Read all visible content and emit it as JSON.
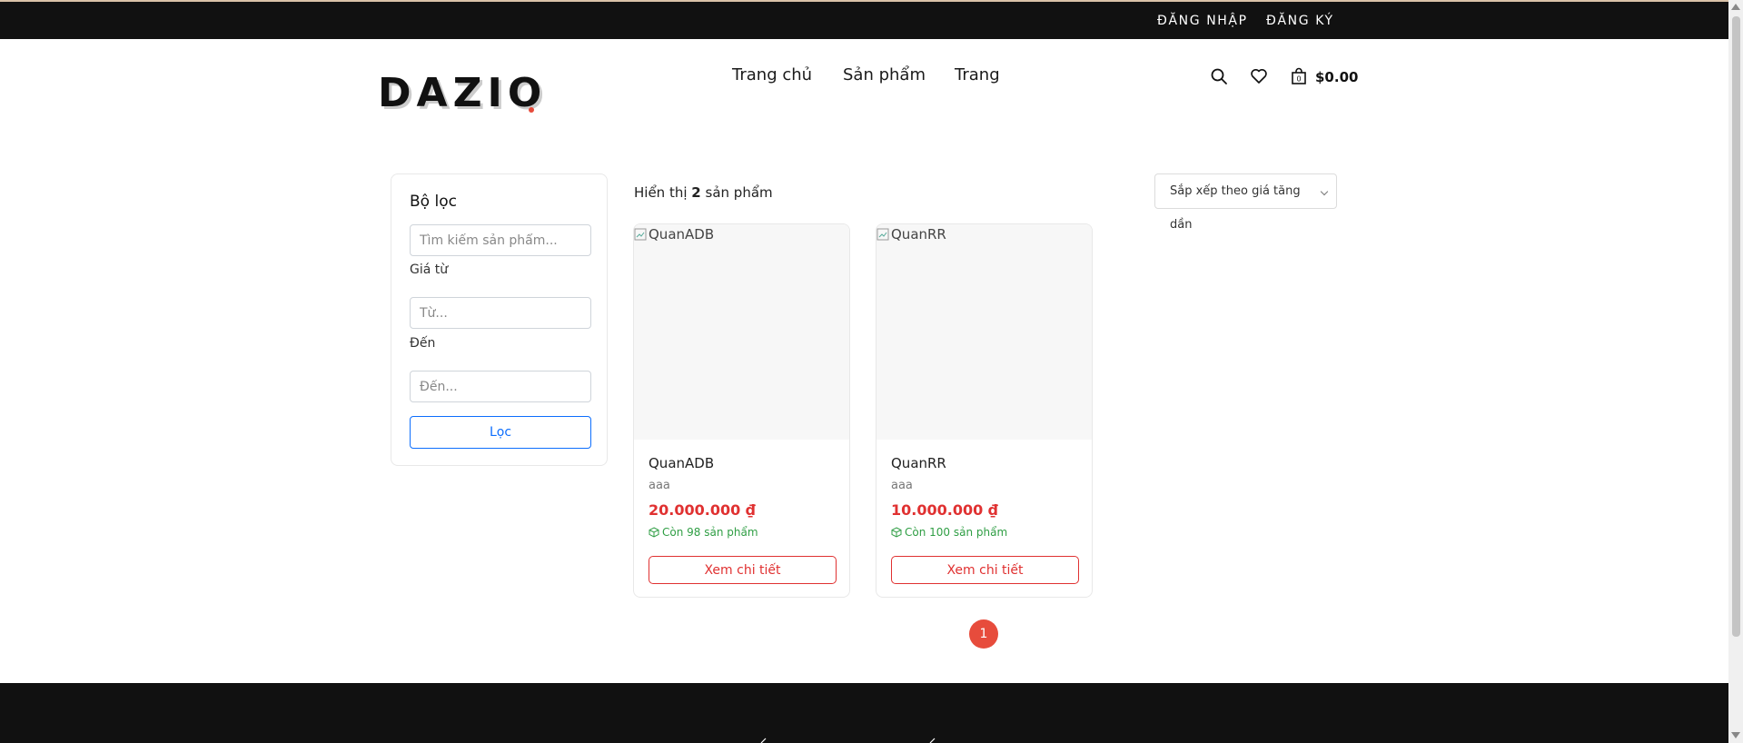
{
  "topbar": {
    "login_label": "ĐĂNG NHẬP",
    "register_label": "ĐĂNG KÝ"
  },
  "header": {
    "logo_text": "DAZIO",
    "nav": [
      {
        "label": "Trang chủ"
      },
      {
        "label": "Sản phẩm"
      },
      {
        "label": "Trang"
      }
    ],
    "cart_total": "$0.00",
    "icons": [
      "search-icon",
      "heart-icon",
      "cart-icon"
    ]
  },
  "filter": {
    "title": "Bộ lọc",
    "search_placeholder": "Tìm kiếm sản phẩm...",
    "price_from_label": "Giá từ",
    "price_from_placeholder": "Từ...",
    "price_to_label": "Đến",
    "price_to_placeholder": "Đến...",
    "submit_label": "Lọc"
  },
  "results": {
    "prefix": "Hiển thị",
    "count": "2",
    "suffix": "sản phẩm",
    "sort_selected": "Sắp xếp theo giá tăng dần"
  },
  "products": [
    {
      "image_alt": "QuanADB",
      "name": "QuanADB",
      "description": "aaa",
      "price": "20.000.000 ₫",
      "stock": "Còn 98 sản phẩm",
      "button_label": "Xem chi tiết"
    },
    {
      "image_alt": "QuanRR",
      "name": "QuanRR",
      "description": "aaa",
      "price": "10.000.000 ₫",
      "stock": "Còn 100 sản phẩm",
      "button_label": "Xem chi tiết"
    }
  ],
  "pagination": {
    "current_page": "1"
  },
  "colors": {
    "accent_red": "#e03131",
    "pagination_red": "#e74c3c",
    "filter_blue": "#0d6efd",
    "stock_green": "#2f9e44",
    "dark_bar": "#111111"
  }
}
